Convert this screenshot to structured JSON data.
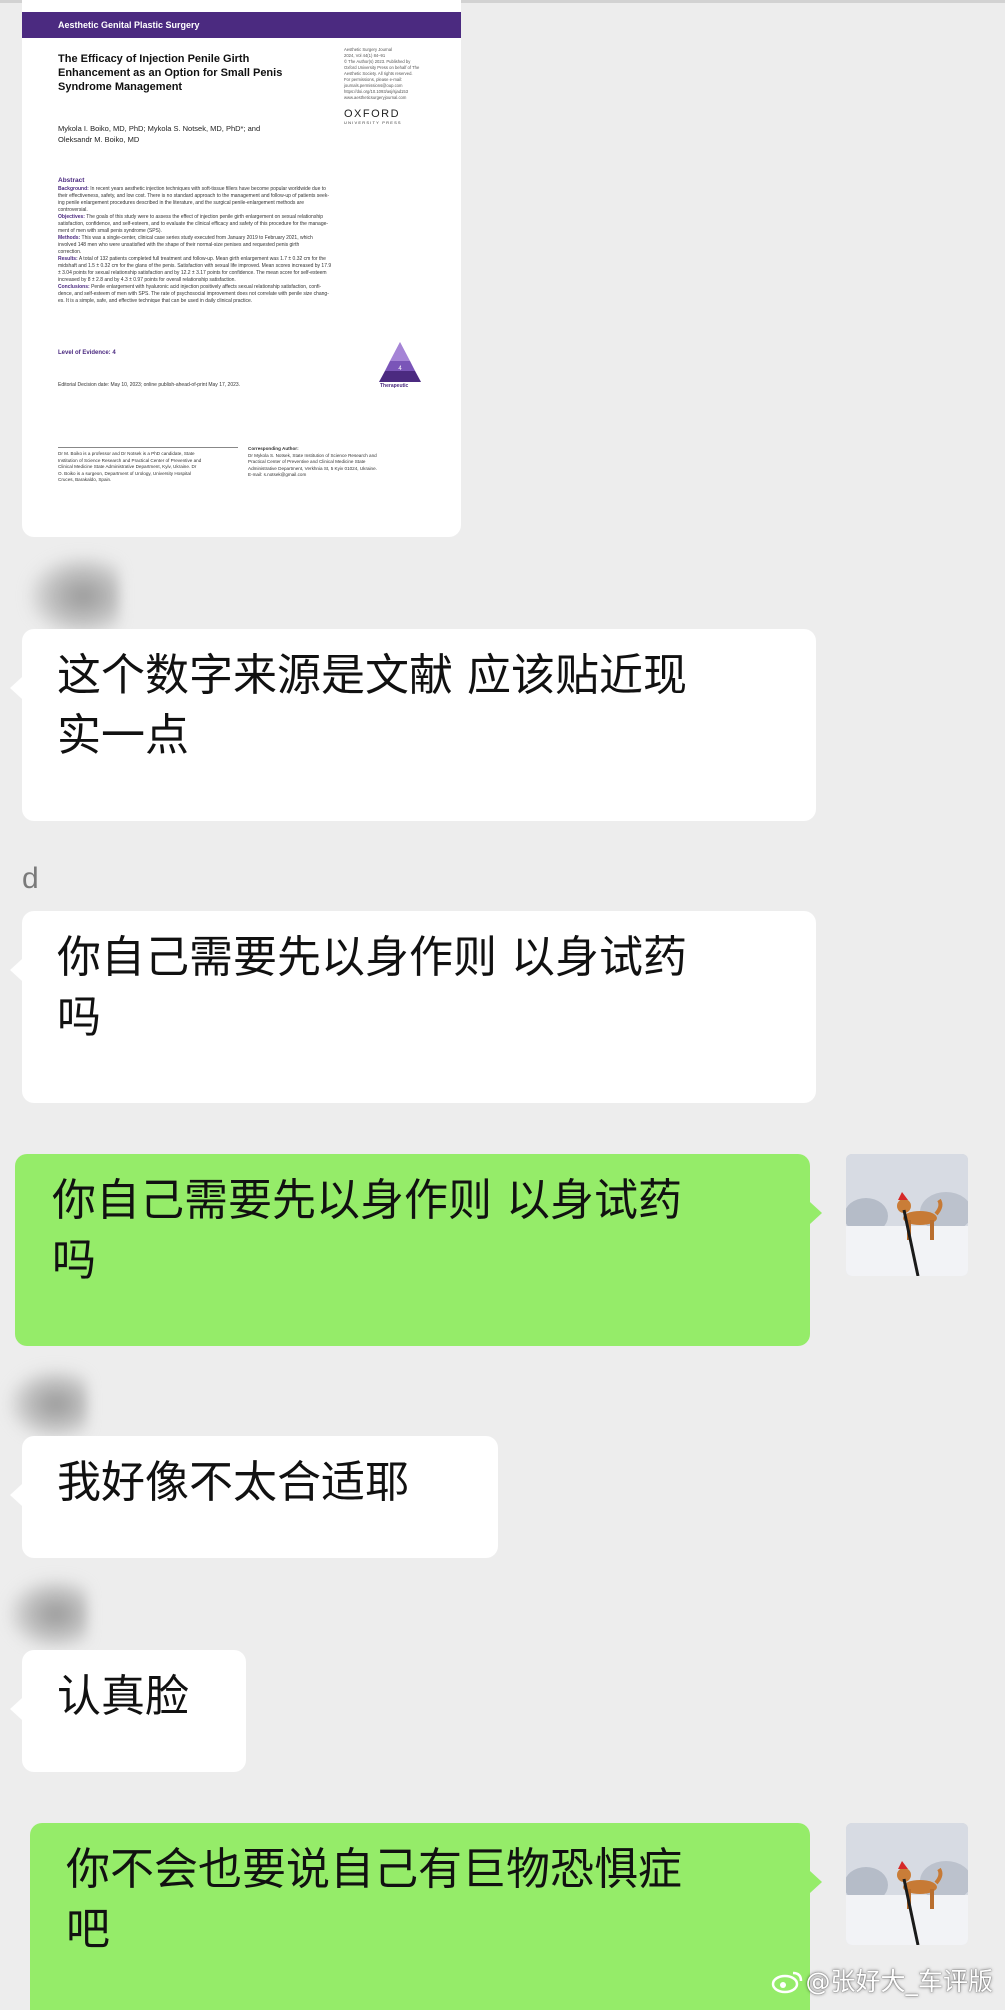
{
  "paper": {
    "banner": "Aesthetic Genital Plastic Surgery",
    "title_lines": [
      "The Efficacy of Injection Penile Girth",
      "Enhancement as an Option for Small Penis",
      "Syndrome Management"
    ],
    "journal_info": [
      "Aesthetic Surgery Journal",
      "2024, Vol 44(1) 84–91",
      "© The Author(s) 2023. Published by",
      "Oxford University Press on behalf of The",
      "Aesthetic Society. All rights reserved.",
      "For permissions, please e-mail:",
      "journals.permissions@oup.com",
      "https://doi.org/10.1093/asj/sjad153",
      "www.aestheticsurgeryjournal.com"
    ],
    "publisher": "OXFORD",
    "publisher_sub": "UNIVERSITY PRESS",
    "authors_lines": [
      "Mykola I. Boiko, MD, PhD; Mykola S. Notsek, MD, PhD*; and",
      "Oleksandr M. Boiko, MD"
    ],
    "abstract_heading": "Abstract",
    "abstract": [
      {
        "label": "Background:",
        "lines": [
          "In recent years aesthetic injection techniques with soft-tissue fillers have become popular worldwide due to",
          "their effectiveness, safety, and low cost. There is no standard approach to the management and follow-up of patients seek-",
          "ing penile enlargement procedures described in the literature, and the surgical penile-enlargement methods are",
          "controversial."
        ]
      },
      {
        "label": "Objectives:",
        "lines": [
          "The goals of this study were to assess the effect of injection penile girth enlargement on sexual relationship",
          "satisfaction, confidence, and self-esteem, and to evaluate the clinical efficacy and safety of this procedure for the manage-",
          "ment of men with small penis syndrome (SPS)."
        ]
      },
      {
        "label": "Methods:",
        "lines": [
          "This was a single-center, clinical case series study executed from January 2019 to February 2021, which",
          "involved 148 men who were unsatisfied with the shape of their normal-size penises and requested penis girth",
          "correction."
        ]
      },
      {
        "label": "Results:",
        "lines": [
          "A total of 132 patients completed full treatment and follow-up. Mean girth enlargement was 1.7 ± 0.32 cm for the",
          "midshaft and 1.5 ± 0.32 cm for the glans of the penis. Satisfaction with sexual life improved. Mean scores increased by 17.9",
          "± 3.04 points for sexual relationship satisfaction and by 12.2 ± 3.17 points for confidence. The mean score for self-esteem",
          "increased by 8 ± 2.8 and by 4.3 ± 0.97 points for overall relationship satisfaction."
        ]
      },
      {
        "label": "Conclusions:",
        "lines": [
          "Penile enlargement with hyaluronic acid injection positively affects sexual relationship satisfaction, confi-",
          "dence, and self-esteem of men with SPS. The rate of psychosocial improvement does not correlate with penile size chang-",
          "es. It is a simple, safe, and effective technique that can be used in daily clinical practice."
        ]
      }
    ],
    "evidence": "Level of Evidence: 4",
    "pyramid_number": "4",
    "therapeutic": "Therapeutic",
    "editorial": "Editorial Decision date: May 10, 2023; online publish-ahead-of-print May 17, 2023.",
    "footnote_left": [
      "Dr M. Boiko is a professor and Dr Notsek is a PhD candidate, State",
      "Institution of Science Research and Practical Center of Preventive and",
      "Clinical Medicine State Administrative Department, Kyiv, Ukraine. Dr",
      "O. Boiko is a surgeon, Department of Urology, University Hospital",
      "Cruces, Barakaldo, Spain."
    ],
    "footnote_right_heading": "Corresponding Author:",
    "footnote_right": [
      "Dr Mykola S. Notsek, State Institution of Science Research and",
      "Practical Center of Preventive and Clinical Medicine State",
      "Administrative Department, Verkhnia St, 5 Kyiv 01024, Ukraine.",
      "E-mail: s.notsek@gmail.com"
    ]
  },
  "messages": [
    {
      "side": "left",
      "lines": [
        "这个数字来源是文献 应该贴近现",
        "实一点"
      ]
    },
    {
      "side": "left",
      "sender": "d",
      "lines": [
        "你自己需要先以身作则 以身试药",
        "吗"
      ]
    },
    {
      "side": "right",
      "lines": [
        "你自己需要先以身作则 以身试药",
        "吗"
      ]
    },
    {
      "side": "left",
      "lines": [
        "我好像不太合适耶"
      ]
    },
    {
      "side": "left",
      "lines": [
        "认真脸"
      ]
    },
    {
      "side": "right",
      "lines": [
        "你不会也要说自己有巨物恐惧症",
        "吧"
      ]
    }
  ],
  "watermark": "@张好大_车评版",
  "colors": {
    "green_bubble": "#95ec69",
    "white_bubble": "#ffffff",
    "background": "#ededed",
    "journal_purple": "#4b2a80"
  }
}
